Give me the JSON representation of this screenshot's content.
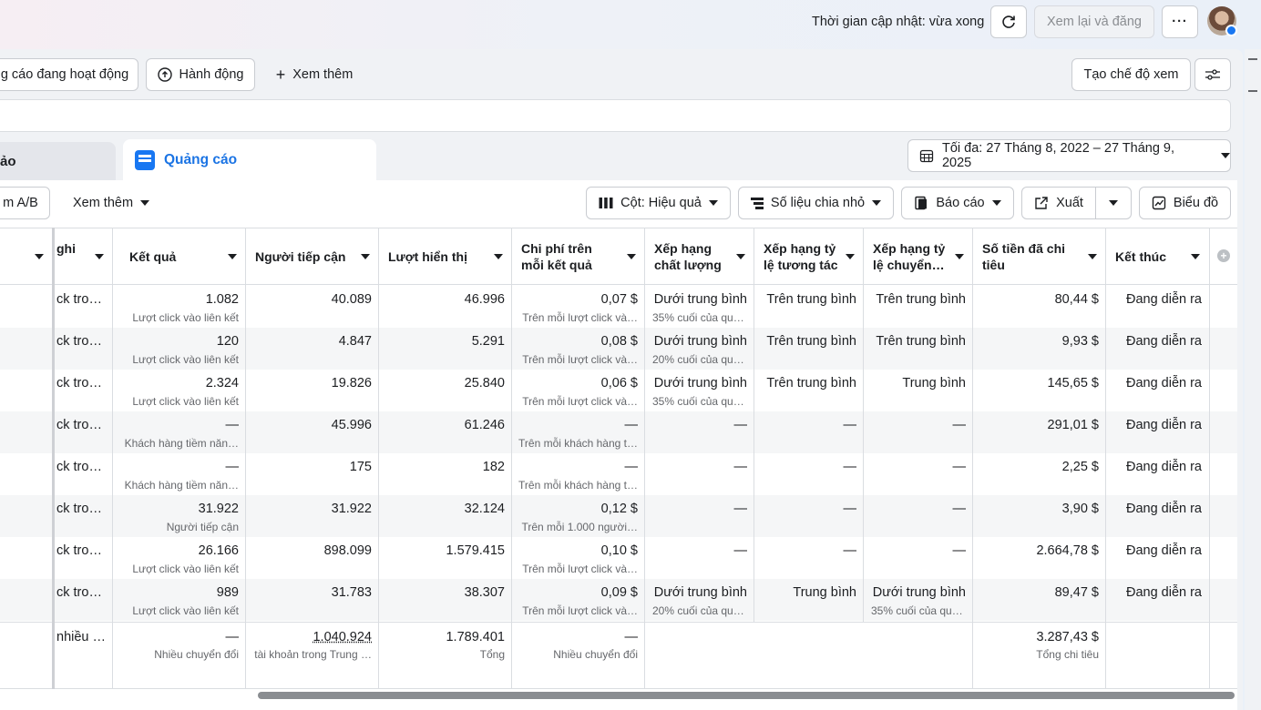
{
  "header": {
    "update_text": "Thời gian cập nhật: vừa xong",
    "review_publish": "Xem lại và đăng"
  },
  "toolbar": {
    "active_ads": "g cáo đang hoạt động",
    "actions": "Hành động",
    "see_more": "Xem thêm",
    "create_view": "Tạo chế độ xem"
  },
  "tabs": {
    "left_partial": "ảo",
    "ads": "Quảng cáo"
  },
  "date_range": "Tối đa: 27 Tháng 8, 2022 – 27 Tháng 9, 2025",
  "table_toolbar": {
    "ab_test": "m A/B",
    "see_more": "Xem thêm",
    "columns": "Cột: Hiệu quả",
    "breakdown": "Số liệu chia nhỏ",
    "reports": "Báo cáo",
    "export": "Xuất",
    "chart": "Biểu đồ"
  },
  "columns": [
    {
      "label": ""
    },
    {
      "label": "ghi"
    },
    {
      "label": "Kết quả"
    },
    {
      "label": "Người tiếp cận"
    },
    {
      "label": "Lượt hiển thị"
    },
    {
      "label": "Chi phí trên mỗi kết quả"
    },
    {
      "label": "Xếp hạng chất lượng"
    },
    {
      "label": "Xếp hạng tỷ lệ tương tác"
    },
    {
      "label": "Xếp hạng tỷ lệ chuyển…"
    },
    {
      "label": "Số tiền đã chi tiêu"
    },
    {
      "label": "Kết thúc"
    }
  ],
  "rows": [
    {
      "type": "ck tro…",
      "result": "1.082",
      "result_sub": "Lượt click vào liên kết",
      "reach": "40.089",
      "impr": "46.996",
      "cpr": "0,07 $",
      "cpr_sub": "Trên mỗi lượt click và…",
      "quality": "Dưới trung bình",
      "quality_sub": "35% cuối của qu…",
      "engage": "Trên trung bình",
      "conv": "Trên trung bình",
      "conv_sub": "",
      "spent": "80,44 $",
      "end": "Đang diễn ra"
    },
    {
      "type": "ck tro…",
      "result": "120",
      "result_sub": "Lượt click vào liên kết",
      "reach": "4.847",
      "impr": "5.291",
      "cpr": "0,08 $",
      "cpr_sub": "Trên mỗi lượt click và…",
      "quality": "Dưới trung bình",
      "quality_sub": "20% cuối của qu…",
      "engage": "Trên trung bình",
      "conv": "Trên trung bình",
      "conv_sub": "",
      "spent": "9,93 $",
      "end": "Đang diễn ra"
    },
    {
      "type": "ck tro…",
      "result": "2.324",
      "result_sub": "Lượt click vào liên kết",
      "reach": "19.826",
      "impr": "25.840",
      "cpr": "0,06 $",
      "cpr_sub": "Trên mỗi lượt click và…",
      "quality": "Dưới trung bình",
      "quality_sub": "35% cuối của qu…",
      "engage": "Trên trung bình",
      "conv": "Trung bình",
      "conv_sub": "",
      "spent": "145,65 $",
      "end": "Đang diễn ra"
    },
    {
      "type": "ck tro…",
      "result": "—",
      "result_sub": "Khách hàng tiềm năn…",
      "reach": "45.996",
      "impr": "61.246",
      "cpr": "—",
      "cpr_sub": "Trên mỗi khách hàng t…",
      "quality": "—",
      "quality_sub": "",
      "engage": "—",
      "conv": "—",
      "conv_sub": "",
      "spent": "291,01 $",
      "end": "Đang diễn ra"
    },
    {
      "type": "ck tro…",
      "result": "—",
      "result_sub": "Khách hàng tiềm năn…",
      "reach": "175",
      "impr": "182",
      "cpr": "—",
      "cpr_sub": "Trên mỗi khách hàng t…",
      "quality": "—",
      "quality_sub": "",
      "engage": "—",
      "conv": "—",
      "conv_sub": "",
      "spent": "2,25 $",
      "end": "Đang diễn ra"
    },
    {
      "type": "ck tro…",
      "result": "31.922",
      "result_sub": "Người tiếp cận",
      "reach": "31.922",
      "impr": "32.124",
      "cpr": "0,12 $",
      "cpr_sub": "Trên mỗi 1.000 người…",
      "quality": "—",
      "quality_sub": "",
      "engage": "—",
      "conv": "—",
      "conv_sub": "",
      "spent": "3,90 $",
      "end": "Đang diễn ra"
    },
    {
      "type": "ck tro…",
      "result": "26.166",
      "result_sub": "Lượt click vào liên kết",
      "reach": "898.099",
      "impr": "1.579.415",
      "cpr": "0,10 $",
      "cpr_sub": "Trên mỗi lượt click và…",
      "quality": "—",
      "quality_sub": "",
      "engage": "—",
      "conv": "—",
      "conv_sub": "",
      "spent": "2.664,78 $",
      "end": "Đang diễn ra"
    },
    {
      "type": "ck tro…",
      "result": "989",
      "result_sub": "Lượt click vào liên kết",
      "reach": "31.783",
      "impr": "38.307",
      "cpr": "0,09 $",
      "cpr_sub": "Trên mỗi lượt click và…",
      "quality": "Dưới trung bình",
      "quality_sub": "20% cuối của qu…",
      "engage": "Trung bình",
      "conv": "Dưới trung bình",
      "conv_sub": "35% cuối của qu…",
      "spent": "89,47 $",
      "end": "Đang diễn ra"
    }
  ],
  "totals": {
    "type": "nhiều …",
    "result": "—",
    "result_sub": "Nhiều chuyển đổi",
    "reach": "1.040.924",
    "reach_sub": "tài khoản trong Trung …",
    "impr": "1.789.401",
    "impr_sub": "Tổng",
    "cpr": "—",
    "cpr_sub": "Nhiều chuyển đổi",
    "spent": "3.287,43 $",
    "spent_sub": "Tổng chi tiêu"
  },
  "colors": {
    "accent": "#1b74e4",
    "border": "#dadde1",
    "muted": "#65676b"
  }
}
